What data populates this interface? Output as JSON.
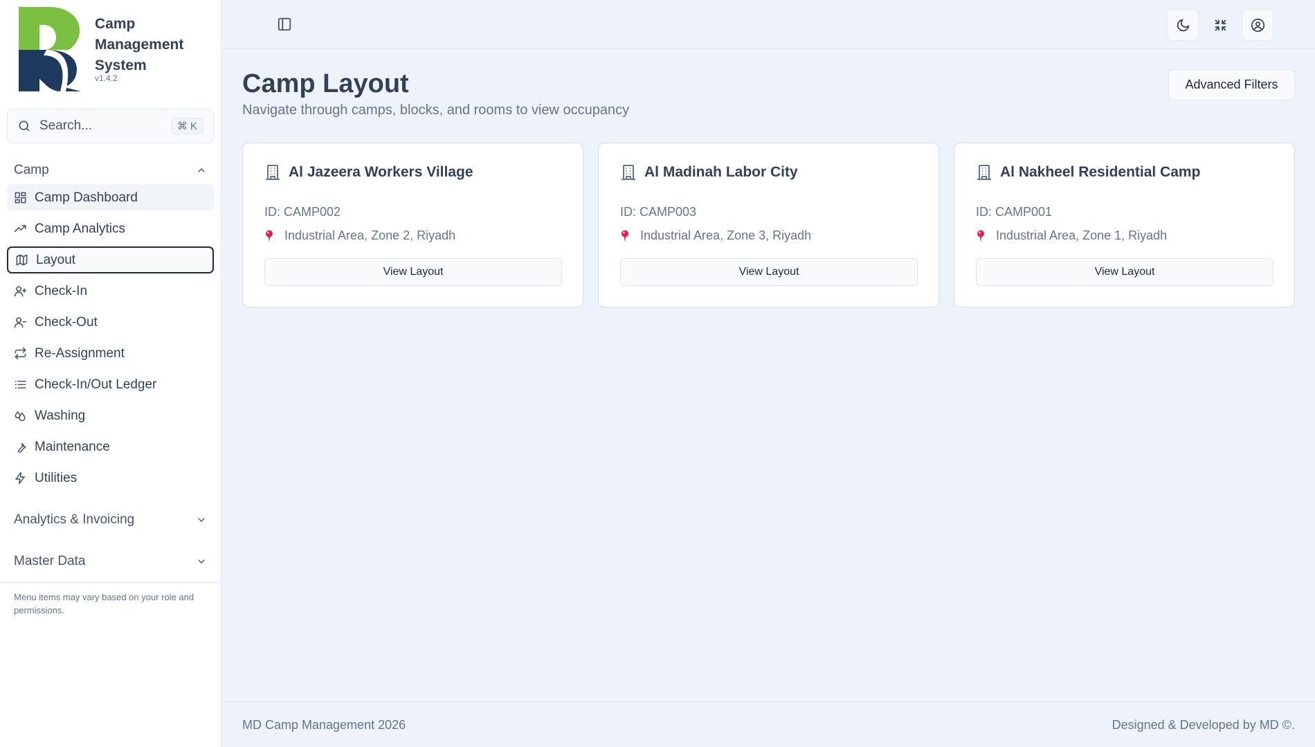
{
  "brand": {
    "title": "Camp Management System",
    "version": "v1.4.2",
    "logo_colors": {
      "green": "#7bc043",
      "navy": "#1e3a5f"
    }
  },
  "search": {
    "placeholder": "Search...",
    "shortcut": "⌘ K"
  },
  "sidebar": {
    "sections": [
      {
        "label": "Camp",
        "expanded": true
      },
      {
        "label": "Analytics & Invoicing",
        "expanded": false
      },
      {
        "label": "Master Data",
        "expanded": false
      }
    ],
    "items": [
      {
        "label": "Camp Dashboard",
        "icon": "dashboard-grid-icon"
      },
      {
        "label": "Camp Analytics",
        "icon": "trending-up-icon"
      },
      {
        "label": "Layout",
        "icon": "map-icon",
        "active": true
      },
      {
        "label": "Check-In",
        "icon": "user-plus-icon"
      },
      {
        "label": "Check-Out",
        "icon": "user-icon"
      },
      {
        "label": "Re-Assignment",
        "icon": "repeat-icon"
      },
      {
        "label": "Check-In/Out Ledger",
        "icon": "list-icon"
      },
      {
        "label": "Washing",
        "icon": "droplets-icon"
      },
      {
        "label": "Maintenance",
        "icon": "wrench-icon"
      },
      {
        "label": "Utilities",
        "icon": "zap-icon"
      }
    ],
    "note": "Menu items may vary based on your role and permissions."
  },
  "topbar": {
    "icons": [
      "sidebar-toggle-icon",
      "moon-icon",
      "minimize-icon",
      "user-circle-icon"
    ]
  },
  "main": {
    "title": "Camp Layout",
    "subtitle": "Navigate through camps, blocks, and rooms to view occupancy",
    "advanced_filters_label": "Advanced Filters",
    "cards": [
      {
        "name": "Al Jazeera Workers Village",
        "id": "ID: CAMP002",
        "location": "Industrial Area, Zone 2, Riyadh",
        "button": "View Layout"
      },
      {
        "name": "Al Madinah Labor City",
        "id": "ID: CAMP003",
        "location": "Industrial Area, Zone 3, Riyadh",
        "button": "View Layout"
      },
      {
        "name": "Al Nakheel Residential Camp",
        "id": "ID: CAMP001",
        "location": "Industrial Area, Zone 1, Riyadh",
        "button": "View Layout"
      }
    ]
  },
  "footer": {
    "left": "MD Camp Management 2026",
    "right": "Designed & Developed by MD ©."
  },
  "colors": {
    "page_bg": "#eef3fb",
    "sidebar_bg": "#ffffff",
    "text": "#334155",
    "muted": "#64748b",
    "pin": "#e11d48"
  }
}
